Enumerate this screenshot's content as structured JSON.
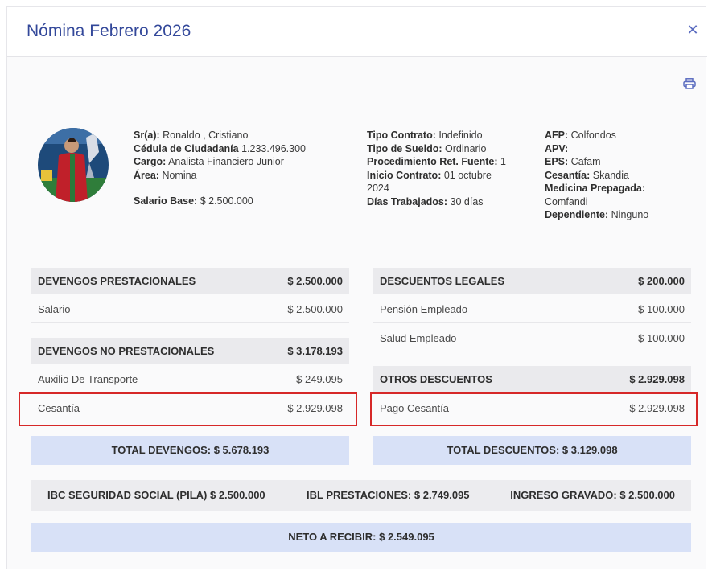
{
  "title": "Nómina Febrero 2026",
  "employee": {
    "name_label": "Sr(a):",
    "name_value": " Ronaldo , Cristiano",
    "id_label": "Cédula de Ciudadanía",
    "id_value": " 1.233.496.300",
    "cargo_label": "Cargo:",
    "cargo_value": " Analista Financiero Junior",
    "area_label": "Área:",
    "area_value": " Nomina",
    "salary_label": "Salario Base:",
    "salary_value": " $ 2.500.000"
  },
  "contract": {
    "tipo_contrato_label": "Tipo Contrato:",
    "tipo_contrato_value": " Indefinido",
    "tipo_sueldo_label": "Tipo de Sueldo:",
    "tipo_sueldo_value": " Ordinario",
    "procedimiento_label": "Procedimiento Ret. Fuente:",
    "procedimiento_value": " 1",
    "inicio_label": "Inicio Contrato:",
    "inicio_value_1": " 01 octubre",
    "inicio_value_2": "2024",
    "dias_label": "Días Trabajados:",
    "dias_value": " 30 días"
  },
  "entities": {
    "afp_label": "AFP:",
    "afp_value": " Colfondos",
    "apv_label": "APV:",
    "apv_value": "",
    "eps_label": "EPS:",
    "eps_value": " Cafam",
    "cesantia_label": "Cesantía:",
    "cesantia_value": " Skandia",
    "medicina_label": "Medicina Prepagada:",
    "medicina_value": "Comfandi",
    "dependiente_label": "Dependiente:",
    "dependiente_value": " Ninguno"
  },
  "devengos": {
    "prestacionales": {
      "label": "DEVENGOS PRESTACIONALES",
      "total": "$ 2.500.000",
      "items": [
        {
          "label": "Salario",
          "value": "$ 2.500.000"
        }
      ]
    },
    "no_prestacionales": {
      "label": "DEVENGOS NO PRESTACIONALES",
      "total": "$ 3.178.193",
      "items": [
        {
          "label": "Auxilio De Transporte",
          "value": "$ 249.095"
        },
        {
          "label": "Cesantía",
          "value": "$ 2.929.098"
        }
      ]
    },
    "total": "TOTAL DEVENGOS: $ 5.678.193"
  },
  "descuentos": {
    "legales": {
      "label": "DESCUENTOS LEGALES",
      "total": "$ 200.000",
      "items": [
        {
          "label": "Pensión Empleado",
          "value": "$ 100.000"
        },
        {
          "label": "Salud Empleado",
          "value": "$ 100.000"
        }
      ]
    },
    "otros": {
      "label": "OTROS DESCUENTOS",
      "total": "$ 2.929.098",
      "items": [
        {
          "label": "Pago Cesantía",
          "value": "$ 2.929.098"
        }
      ]
    },
    "total": "TOTAL DESCUENTOS: $ 3.129.098"
  },
  "summary": {
    "ibc": "IBC SEGURIDAD SOCIAL (PILA) $ 2.500.000",
    "ibl": "IBL PRESTACIONES: $ 2.749.095",
    "ingreso": "INGRESO GRAVADO: $ 2.500.000",
    "neto": "NETO A RECIBIR: $ 2.549.095"
  },
  "colors": {
    "title": "#33489a",
    "highlight": "#d62828",
    "total_bg": "#d8e1f7",
    "section_bg": "#eaeaed"
  },
  "icons": {
    "close": "close-icon",
    "print": "print-icon",
    "avatar": "avatar-photo"
  }
}
